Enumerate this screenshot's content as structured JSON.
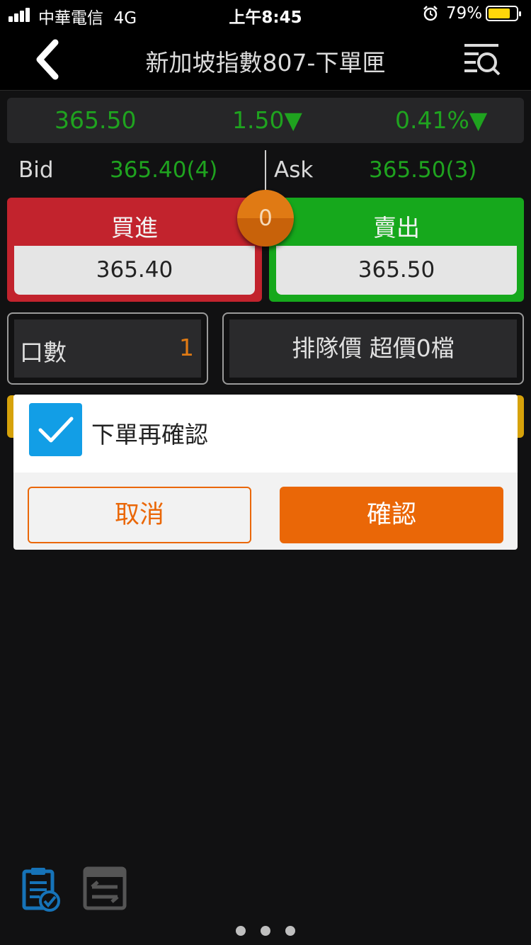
{
  "status_bar": {
    "carrier": "中華電信",
    "network": "4G",
    "time": "上午8:45",
    "battery_percent": "79%",
    "battery_level": 0.79
  },
  "header": {
    "title": "新加坡指數807-下單匣",
    "back_icon": "chevron-left-icon",
    "right_icon": "search-list-icon"
  },
  "quote": {
    "last_price": "365.50",
    "change": "1.50▼",
    "change_pct": "0.41%▼",
    "color": "#1fa31f"
  },
  "bid_ask": {
    "bid_label": "Bid",
    "bid_value": "365.40(4)",
    "ask_label": "Ask",
    "ask_value": "365.50(3)"
  },
  "order": {
    "buy_label": "買進",
    "buy_price": "365.40",
    "sell_label": "賣出",
    "sell_price": "365.50",
    "center_count": "0",
    "qty_label": "口數",
    "qty_value": "1",
    "price_type": "排隊價 超價0檔"
  },
  "dialog": {
    "checkbox_checked": true,
    "message": "下單再確認",
    "cancel_label": "取消",
    "confirm_label": "確認",
    "accent_color": "#ea6707"
  },
  "bottom": {
    "icon_1": "clipboard-check-icon",
    "icon_2": "day-trade-calendar-icon",
    "page_count": 3
  },
  "colors": {
    "buy": "#c2232d",
    "sell": "#16a81c",
    "up_down_green": "#1fa31f",
    "checkbox_blue": "#129ee6"
  }
}
